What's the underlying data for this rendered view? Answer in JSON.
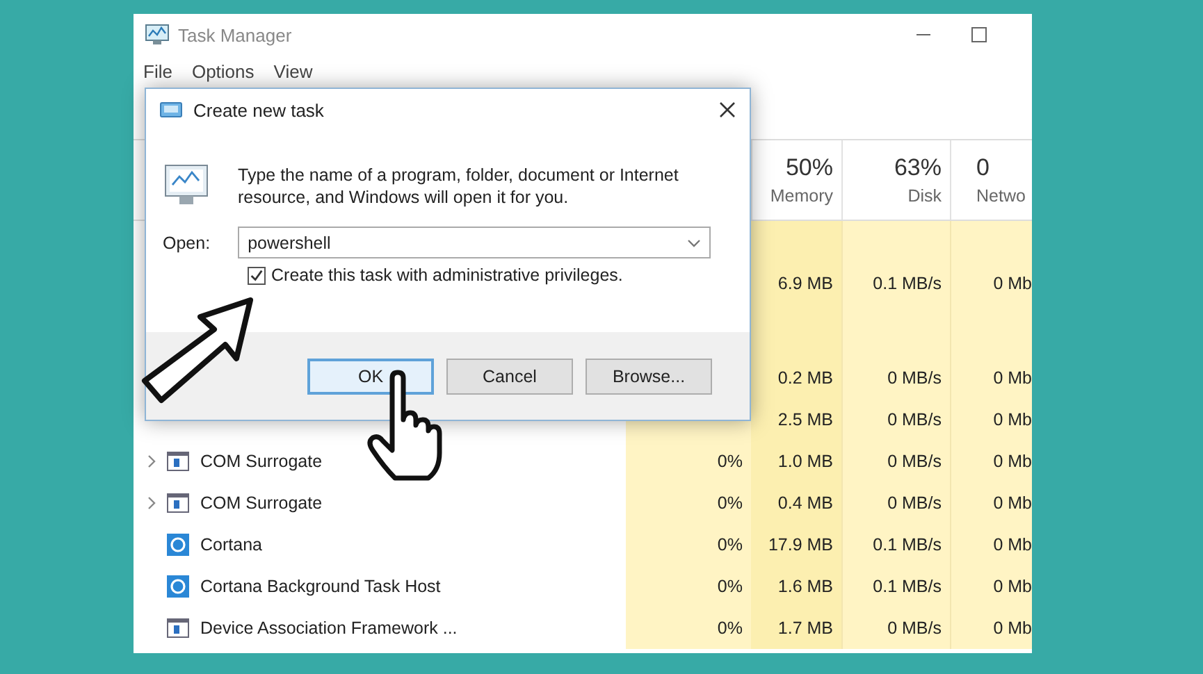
{
  "window": {
    "title": "Task Manager"
  },
  "menu": [
    "File",
    "Options",
    "View"
  ],
  "table": {
    "columns": [
      {
        "value": "50%",
        "label": "Memory"
      },
      {
        "value": "63%",
        "label": "Disk"
      },
      {
        "value": "0",
        "label": "Netwo"
      }
    ],
    "rows": [
      {
        "memory": "6.9 MB",
        "disk": "0.1 MB/s",
        "network": "0 Mb"
      },
      {
        "memory": "0.2 MB",
        "disk": "0 MB/s",
        "network": "0 Mb"
      },
      {
        "memory": "2.5 MB",
        "disk": "0 MB/s",
        "network": "0 Mb"
      },
      {
        "kind": "app",
        "expandable": true,
        "name": "COM Surrogate",
        "cpu": "0%",
        "memory": "1.0 MB",
        "disk": "0 MB/s",
        "network": "0 Mb"
      },
      {
        "kind": "app",
        "expandable": true,
        "name": "COM Surrogate",
        "cpu": "0%",
        "memory": "0.4 MB",
        "disk": "0 MB/s",
        "network": "0 Mb"
      },
      {
        "kind": "cortana",
        "expandable": false,
        "name": "Cortana",
        "cpu": "0%",
        "memory": "17.9 MB",
        "disk": "0.1 MB/s",
        "network": "0 Mb"
      },
      {
        "kind": "cortana",
        "expandable": false,
        "name": "Cortana Background Task Host",
        "cpu": "0%",
        "memory": "1.6 MB",
        "disk": "0.1 MB/s",
        "network": "0 Mb"
      },
      {
        "kind": "app",
        "expandable": false,
        "name": "Device Association Framework ...",
        "cpu": "0%",
        "memory": "1.7 MB",
        "disk": "0 MB/s",
        "network": "0 Mb"
      }
    ]
  },
  "dialog": {
    "title": "Create new task",
    "message": "Type the name of a program, folder, document or Internet resource, and Windows will open it for you.",
    "open_label": "Open:",
    "open_value": "powershell",
    "admin_checkbox": {
      "label": "Create this task with administrative privileges.",
      "checked": true
    },
    "buttons": [
      {
        "label": "OK",
        "selected": true
      },
      {
        "label": "Cancel",
        "selected": false
      },
      {
        "label": "Browse...",
        "selected": false
      }
    ]
  }
}
